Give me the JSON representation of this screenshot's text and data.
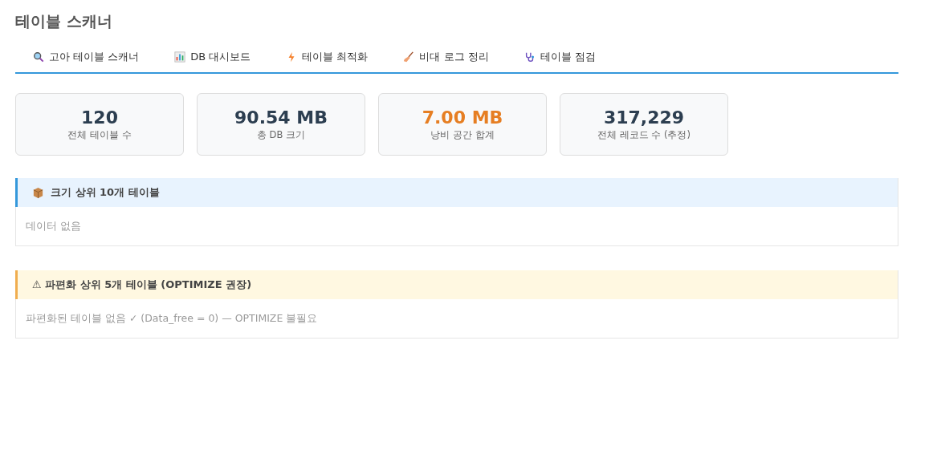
{
  "title": "테이블 스캐너",
  "tabs": [
    {
      "label": "고아 테이블 스캐너"
    },
    {
      "label": "DB 대시보드"
    },
    {
      "label": "테이블 최적화"
    },
    {
      "label": "비대 로그 정리"
    },
    {
      "label": "테이블 점검"
    }
  ],
  "stats": [
    {
      "value": "120",
      "label": "전체 테이블 수",
      "color": "#2c3e50"
    },
    {
      "value": "90.54 MB",
      "label": "총 DB 크기",
      "color": "#2c3e50"
    },
    {
      "value": "7.00 MB",
      "label": "낭비 공간 합계",
      "color": "#e67e22"
    },
    {
      "value": "317,229",
      "label": "전체 레코드 수 (추정)",
      "color": "#2c3e50"
    }
  ],
  "sections": [
    {
      "kind": "info",
      "title": "크기 상위 10개 테이블",
      "body": "데이터 없음"
    },
    {
      "kind": "warning",
      "title": "⚠ 파편화 상위 5개 테이블 (OPTIMIZE 권장)",
      "body": "파편화된 테이블 없음 ✓ (Data_free = 0) — OPTIMIZE 불필요"
    }
  ]
}
